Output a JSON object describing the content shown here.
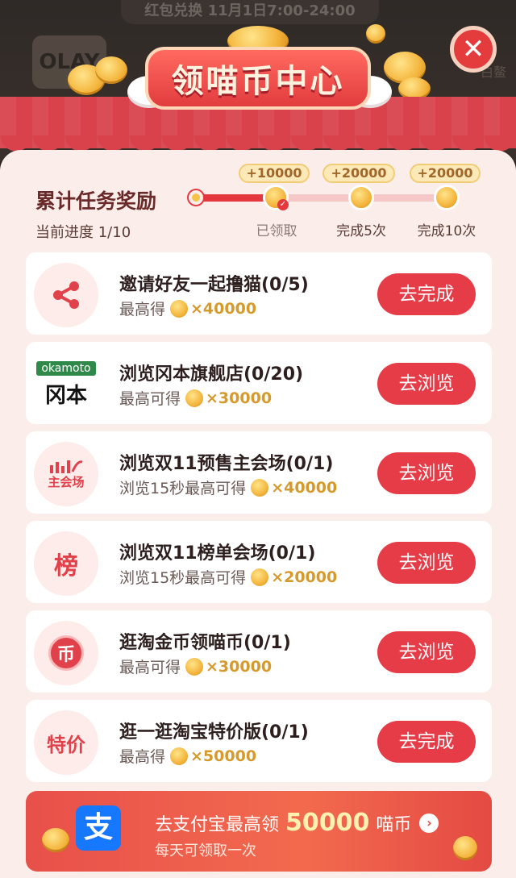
{
  "header": {
    "notice": "红包兑换 11月1日7:00-24:00",
    "bg_brand": "OLAY",
    "bg_right_text": "白鳌",
    "banner_title": "领喵币中心",
    "close_icon": "close-icon"
  },
  "progress": {
    "title": "累计任务奖励",
    "current": "当前进度 1/10",
    "milestones": [
      {
        "reward": "+10000",
        "label": "已领取"
      },
      {
        "reward": "+20000",
        "label": "完成5次"
      },
      {
        "reward": "+20000",
        "label": "完成10次"
      }
    ]
  },
  "tasks": [
    {
      "icon": "share-icon",
      "title": "邀请好友一起撸猫(0/5)",
      "sub": "最高得",
      "amount": "×40000",
      "button": "去完成"
    },
    {
      "icon": "okamoto-logo",
      "logo_top": "okamoto",
      "logo_bottom": "冈本",
      "title": "浏览冈本旗舰店(0/20)",
      "sub": "最高可得",
      "amount": "×30000",
      "button": "去浏览"
    },
    {
      "icon": "main-venue-icon",
      "icon_text": "主会场",
      "title": "浏览双11预售主会场(0/1)",
      "sub": "浏览15秒最高可得",
      "amount": "×40000",
      "button": "去浏览"
    },
    {
      "icon": "ranking-icon",
      "icon_text": "榜",
      "title": "浏览双11榜单会场(0/1)",
      "sub": "浏览15秒最高可得",
      "amount": "×20000",
      "button": "去浏览"
    },
    {
      "icon": "coin-icon",
      "icon_text": "币",
      "title": "逛淘金币领喵币(0/1)",
      "sub": "最高可得",
      "amount": "×30000",
      "button": "去浏览"
    },
    {
      "icon": "special-price-icon",
      "icon_text": "特价",
      "title": "逛一逛淘宝特价版(0/1)",
      "sub": "最高得",
      "amount": "×50000",
      "button": "去完成"
    }
  ],
  "alipay": {
    "logo_text": "支",
    "prefix": "去支付宝最高领",
    "amount": "50000",
    "suffix": "喵币",
    "subtitle": "每天可领取一次"
  },
  "colors": {
    "accent": "#e53c47",
    "panel": "#fbeeea",
    "coin": "#f4b53d",
    "alipay_blue": "#1677ff"
  }
}
